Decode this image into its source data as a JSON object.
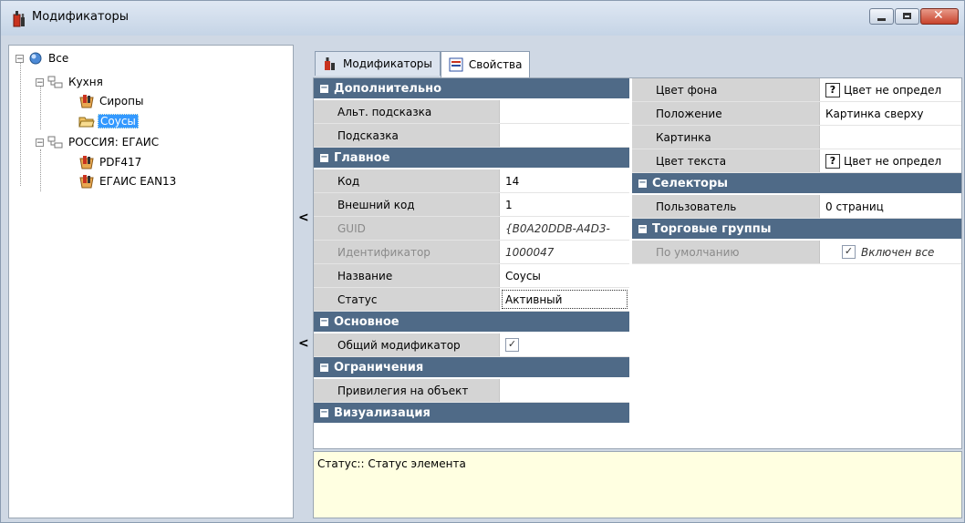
{
  "window": {
    "title": "Модификаторы"
  },
  "tree": {
    "root": "Все",
    "groups": [
      {
        "label": "Кухня",
        "children": [
          "Сиропы",
          "Соусы"
        ]
      },
      {
        "label": "РОССИЯ: ЕГАИС",
        "children": [
          "PDF417",
          "ЕГАИС EAN13"
        ]
      }
    ],
    "selected": "Соусы"
  },
  "tabs": [
    {
      "label": "Модификаторы",
      "icon": "bottle-icon",
      "active": false
    },
    {
      "label": "Свойства",
      "icon": "properties-icon",
      "active": true
    }
  ],
  "left_grid": {
    "categories": [
      {
        "title": "Дополнительно",
        "rows": [
          {
            "name": "Альт. подсказка",
            "value": ""
          },
          {
            "name": "Подсказка",
            "value": ""
          }
        ]
      },
      {
        "title": "Главное",
        "rows": [
          {
            "name": "Код",
            "value": "14"
          },
          {
            "name": "Внешний код",
            "value": "1"
          },
          {
            "name": "GUID",
            "value": "{B0A20DDB-A4D3-",
            "disabled": true
          },
          {
            "name": "Идентификатор",
            "value": "1000047",
            "disabled": true
          },
          {
            "name": "Название",
            "value": "Соусы"
          },
          {
            "name": "Статус",
            "value": "Активный"
          }
        ]
      },
      {
        "title": "Основное",
        "rows": [
          {
            "name": "Общий модификатор",
            "value": "✓"
          }
        ]
      },
      {
        "title": "Ограничения",
        "rows": [
          {
            "name": "Привилегия на объект",
            "value": ""
          }
        ]
      },
      {
        "title": "Визуализация",
        "rows": []
      }
    ]
  },
  "right_grid": {
    "visual_rows": [
      {
        "name": "Цвет фона",
        "value": "Цвет не определ",
        "q": "?"
      },
      {
        "name": "Положение",
        "value": "Картинка сверху"
      },
      {
        "name": "Картинка",
        "value": ""
      },
      {
        "name": "Цвет текста",
        "value": "Цвет не определ",
        "q": "?"
      }
    ],
    "selectors": {
      "title": "Селекторы",
      "rows": [
        {
          "name": "Пользователь",
          "value": "0 страниц"
        }
      ]
    },
    "trade_groups": {
      "title": "Торговые группы",
      "rows": [
        {
          "name": "По умолчанию",
          "value": "Включен все",
          "check": "✓"
        }
      ]
    }
  },
  "description": "Статус:: Статус элемента",
  "splitter": {
    "arrow": "<"
  },
  "colors": {
    "category_bg": "#4f6a87",
    "selection": "#3399ff",
    "desc_bg": "#ffffe1"
  }
}
